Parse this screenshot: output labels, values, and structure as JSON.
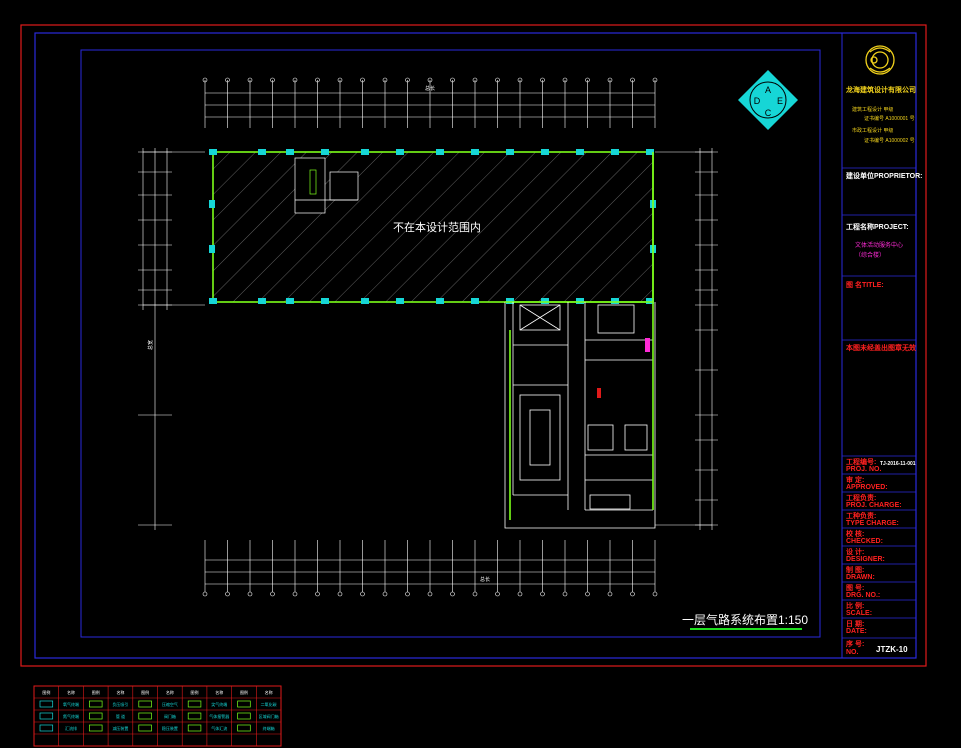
{
  "drawing": {
    "title": "一层气路系统布置1:150",
    "hatch_note": "不在本设计范围内",
    "logo_letters": [
      "A",
      "D",
      "E",
      "C"
    ],
    "dim_top_label": "总长",
    "dim_bottom_label": "总长",
    "dim_left_label": "总宽"
  },
  "title_block": {
    "company": "龙海建筑设计有限公司",
    "certs": [
      "建筑工程设计 甲级",
      "证书编号 A1000001 号",
      "市政工程设计 甲级",
      "证书编号 A1000002 号"
    ],
    "proprietor_label": "建设单位PROPRIETOR:",
    "project_label": "工程名称PROJECT:",
    "project_lines": [
      "文体活动服务中心",
      "（综合楼）"
    ],
    "title_label": "图 名TITLE:",
    "stamp_note": "本图未经盖出图章无效",
    "rows": [
      {
        "label": "工程编号:",
        "sub": "PROJ. NO.",
        "value": "TJ-2016-11-001"
      },
      {
        "label": "审 定:",
        "sub": "APPROVED:",
        "value": ""
      },
      {
        "label": "工程负责:",
        "sub": "PROJ. CHARGE:",
        "value": ""
      },
      {
        "label": "工种负责:",
        "sub": "TYPE CHARGE:",
        "value": ""
      },
      {
        "label": "校 核:",
        "sub": "CHECKED:",
        "value": ""
      },
      {
        "label": "设 计:",
        "sub": "DESIGNER:",
        "value": ""
      },
      {
        "label": "制 图:",
        "sub": "DRAWN:",
        "value": ""
      },
      {
        "label": "图 号:",
        "sub": "DRG. NO.:",
        "value": ""
      },
      {
        "label": "比 例:",
        "sub": "SCALE:",
        "value": ""
      },
      {
        "label": "日 期:",
        "sub": "DATE:",
        "value": ""
      }
    ],
    "sheet_label": "序 号:",
    "sheet_sub": "NO.",
    "sheet_value": "JTZK-10"
  },
  "legend": {
    "headers": [
      "图例",
      "名称",
      "图例",
      "名称",
      "图例",
      "名称",
      "图例",
      "名称",
      "图例",
      "名称"
    ],
    "rows": [
      [
        "",
        "氧气终端",
        "",
        "负压吸引",
        "",
        "压缩空气",
        "",
        "笑气终端",
        "",
        "二氧化碳"
      ],
      [
        "",
        "氮气终端",
        "",
        "管 道",
        "",
        "阀门箱",
        "",
        "气体报警器",
        "",
        "区域阀门箱"
      ],
      [
        "",
        "汇流排",
        "",
        "减压装置",
        "",
        "稳压装置",
        "",
        "气体汇流",
        "",
        "终端箱"
      ]
    ]
  },
  "colors": {
    "frame_red": "#e01a1a",
    "frame_blue": "#2a2adb",
    "wall": "#ffffff",
    "outline": "#7cff1a",
    "cyan": "#16d6d6",
    "magenta": "#ff2bd6",
    "title_green": "#20e020",
    "logo_yellow": "#f2d21c"
  }
}
